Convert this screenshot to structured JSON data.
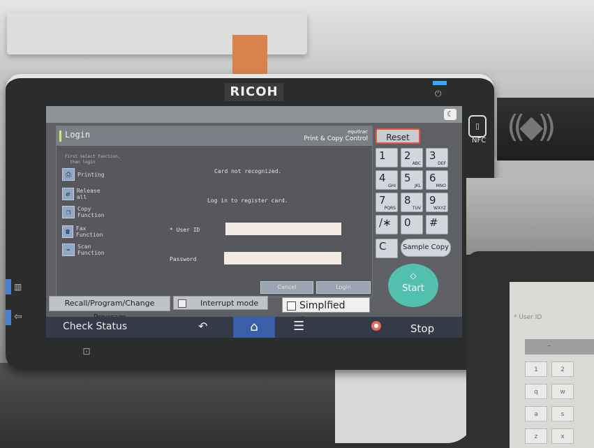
{
  "device": {
    "brand": "RICOH",
    "nfc_label": "NFC"
  },
  "login": {
    "title": "Login",
    "brand_line1": "equitrac",
    "brand_line2": "Print & Copy Control",
    "hint": "First select function,\n  then login",
    "functions": [
      {
        "label": "Printing",
        "icon": "printer-icon"
      },
      {
        "label": "Release all",
        "icon": "release-icon"
      },
      {
        "label": "Copy\nFunction",
        "icon": "copy-icon"
      },
      {
        "label": "Fax Function",
        "icon": "fax-icon"
      },
      {
        "label": "Scan\nFunction",
        "icon": "scan-icon"
      }
    ],
    "message1": "Card not recognized.",
    "message2": "Log in to register card.",
    "userid_label": "* User ID",
    "password_label": "Password",
    "userid_value": "",
    "password_value": "",
    "cancel_label": "Cancel",
    "login_label": "Login"
  },
  "controls": {
    "recall_label": "Recall/Program/Change Program",
    "interrupt_label": "Interrupt mode",
    "simplified_label": "Simplfied Scrn."
  },
  "keypad": {
    "reset_label": "Reset",
    "keys": [
      {
        "d": "1",
        "s": ""
      },
      {
        "d": "2",
        "s": "ABC"
      },
      {
        "d": "3",
        "s": "DEF"
      },
      {
        "d": "4",
        "s": "GHI"
      },
      {
        "d": "5",
        "s": "JKL"
      },
      {
        "d": "6",
        "s": "MNO"
      },
      {
        "d": "7",
        "s": "PQRS"
      },
      {
        "d": "8",
        "s": "TUV"
      },
      {
        "d": "9",
        "s": "WXYZ"
      },
      {
        "d": "/∗",
        "s": ""
      },
      {
        "d": "0",
        "s": ""
      },
      {
        "d": "#",
        "s": ""
      }
    ],
    "clear_label": "C",
    "sample_copy_label": "Sample Copy",
    "start_label": "Start"
  },
  "statusbar": {
    "check_status_label": "Check Status",
    "stop_label": "Stop"
  },
  "second_panel": {
    "userid_label": "* User ID",
    "keys": [
      "1",
      "2",
      "q",
      "w",
      "a",
      "s",
      "z",
      "x"
    ]
  }
}
